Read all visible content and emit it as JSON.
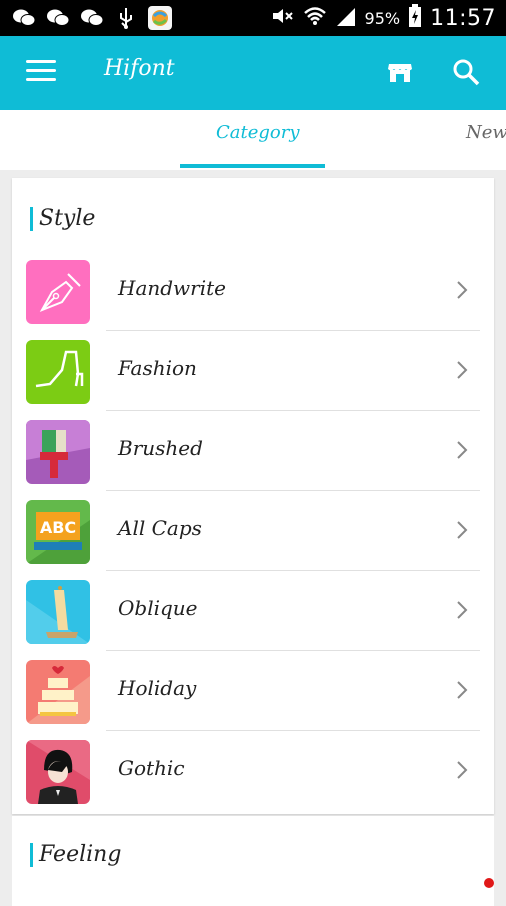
{
  "status": {
    "battery": "95%",
    "time": "11:57"
  },
  "app": {
    "title": "Hifont"
  },
  "tabs": [
    {
      "label": "Category"
    },
    {
      "label": "New"
    }
  ],
  "sections": [
    {
      "title": "Style",
      "items": [
        {
          "label": "Handwrite",
          "color": "#ff6fbf"
        },
        {
          "label": "Fashion",
          "color": "#7ccc14"
        },
        {
          "label": "Brushed",
          "color": "#a55bb9"
        },
        {
          "label": "All Caps",
          "color": "#63b94b"
        },
        {
          "label": "Oblique",
          "color": "#30c1e5"
        },
        {
          "label": "Holiday",
          "color": "#f47b72"
        },
        {
          "label": "Gothic",
          "color": "#e04c6a"
        }
      ]
    },
    {
      "title": "Feeling",
      "items": []
    }
  ],
  "colors": {
    "accent": "#0fbcd6"
  }
}
